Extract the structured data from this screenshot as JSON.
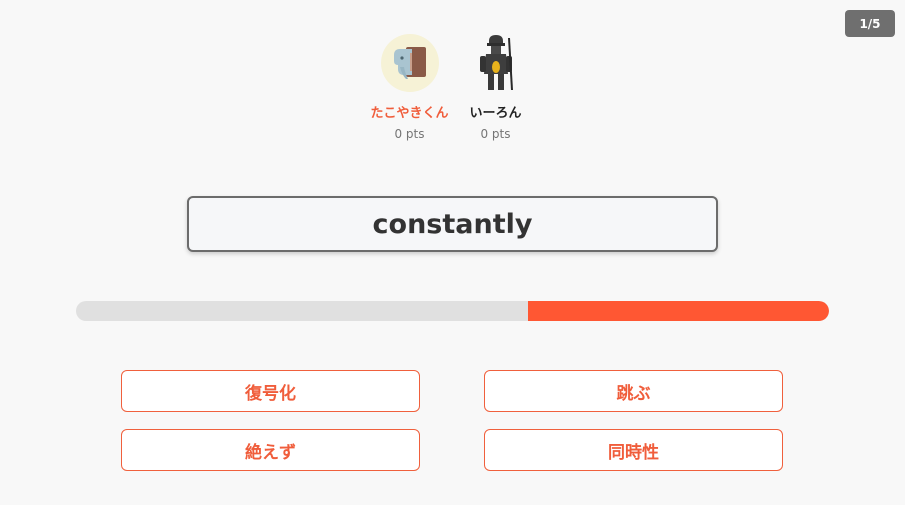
{
  "round": {
    "label": "1/5"
  },
  "players": [
    {
      "name": "たこやきくん",
      "score": "0 pts",
      "avatar_icon": "elephant-icon",
      "active": true
    },
    {
      "name": "いーろん",
      "score": "0 pts",
      "avatar_icon": "armored-soldier-icon",
      "active": false
    }
  ],
  "question": {
    "word": "constantly"
  },
  "timer": {
    "remaining_fraction": 0.4
  },
  "answers": [
    {
      "label": "復号化"
    },
    {
      "label": "跳ぶ"
    },
    {
      "label": "絶えず"
    },
    {
      "label": "同時性"
    }
  ],
  "colors": {
    "accent": "#ff5733",
    "answer_text": "#f05d3b",
    "active_name": "#f05d3b",
    "badge_bg": "#6f6f6f",
    "track": "#e0e0e0",
    "background": "#f8f8f8"
  }
}
